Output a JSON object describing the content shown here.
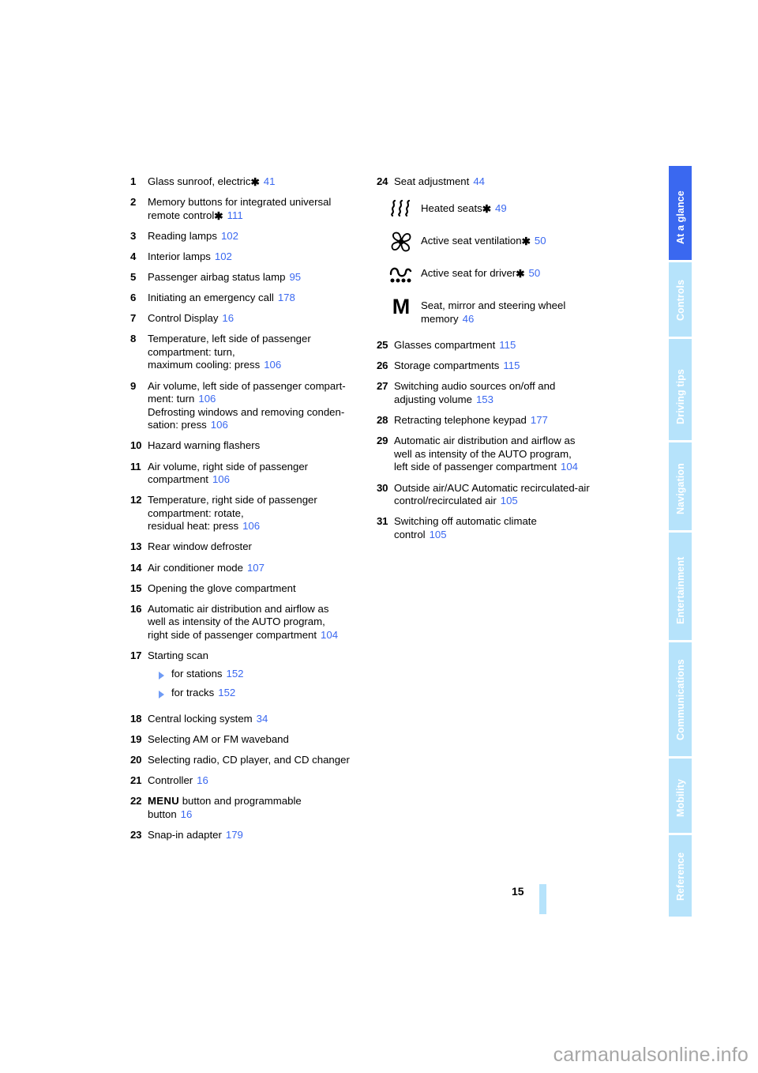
{
  "page": {
    "number": "15",
    "watermark": "carmanualsonline.info"
  },
  "colors": {
    "accent_blue": "#3a68f0",
    "tab_inactive": "#b6e3fb",
    "tab_active": "#3a68f0",
    "watermark_gray": "#a6a6a6"
  },
  "sidebar": {
    "tabs": [
      {
        "label": "At a glance",
        "active": true
      },
      {
        "label": "Controls",
        "active": false
      },
      {
        "label": "Driving tips",
        "active": false
      },
      {
        "label": "Navigation",
        "active": false
      },
      {
        "label": "Entertainment",
        "active": false
      },
      {
        "label": "Communications",
        "active": false
      },
      {
        "label": "Mobility",
        "active": false
      },
      {
        "label": "Reference",
        "active": false
      }
    ]
  },
  "left_column": {
    "entries": [
      {
        "num": "1",
        "lines": [
          {
            "text": "Glass sunroof, electric",
            "star": true,
            "page": "41"
          }
        ]
      },
      {
        "num": "2",
        "lines": [
          {
            "text": "Memory buttons for integrated universal"
          },
          {
            "text": "remote control",
            "star": true,
            "page": "111"
          }
        ]
      },
      {
        "num": "3",
        "lines": [
          {
            "text": "Reading lamps",
            "page": "102"
          }
        ]
      },
      {
        "num": "4",
        "lines": [
          {
            "text": "Interior lamps",
            "page": "102"
          }
        ]
      },
      {
        "num": "5",
        "lines": [
          {
            "text": "Passenger airbag status lamp",
            "page": "95"
          }
        ]
      },
      {
        "num": "6",
        "lines": [
          {
            "text": "Initiating an emergency call",
            "page": "178"
          }
        ]
      },
      {
        "num": "7",
        "lines": [
          {
            "text": "Control Display",
            "page": "16"
          }
        ]
      },
      {
        "num": "8",
        "lines": [
          {
            "text": "Temperature, left side of passenger"
          },
          {
            "text": "compartment: turn,"
          },
          {
            "text": "maximum cooling: press",
            "page": "106"
          }
        ]
      },
      {
        "num": "9",
        "lines": [
          {
            "text": "Air volume, left side of passenger compart-"
          },
          {
            "text": "ment: turn",
            "page": "106"
          },
          {
            "text": "Defrosting windows and removing conden-"
          },
          {
            "text": "sation: press",
            "page": "106"
          }
        ]
      },
      {
        "num": "10",
        "lines": [
          {
            "text": "Hazard warning flashers"
          }
        ]
      },
      {
        "num": "11",
        "lines": [
          {
            "text": "Air volume, right side of passenger"
          },
          {
            "text": "compartment",
            "page": "106"
          }
        ]
      },
      {
        "num": "12",
        "lines": [
          {
            "text": "Temperature, right side of passenger"
          },
          {
            "text": "compartment: rotate,"
          },
          {
            "text": "residual heat: press",
            "page": "106"
          }
        ]
      },
      {
        "num": "13",
        "lines": [
          {
            "text": "Rear window defroster"
          }
        ]
      },
      {
        "num": "14",
        "lines": [
          {
            "text": "Air conditioner mode",
            "page": "107"
          }
        ]
      },
      {
        "num": "15",
        "lines": [
          {
            "text": "Opening the glove compartment"
          }
        ]
      },
      {
        "num": "16",
        "lines": [
          {
            "text": "Automatic air distribution and airflow as"
          },
          {
            "text": "well as intensity of the AUTO program,"
          },
          {
            "text": "right side of passenger compartment",
            "page": "104"
          }
        ]
      },
      {
        "num": "17",
        "lines": [
          {
            "text": "Starting scan"
          }
        ],
        "subs": [
          {
            "text": "for stations",
            "page": "152"
          },
          {
            "text": "for tracks",
            "page": "152"
          }
        ]
      },
      {
        "num": "18",
        "lines": [
          {
            "text": "Central locking system",
            "page": "34"
          }
        ]
      },
      {
        "num": "19",
        "lines": [
          {
            "text": "Selecting AM or FM waveband"
          }
        ]
      },
      {
        "num": "20",
        "lines": [
          {
            "text": "Selecting radio, CD player, and CD changer"
          }
        ]
      },
      {
        "num": "21",
        "lines": [
          {
            "text": "Controller",
            "page": "16"
          }
        ]
      },
      {
        "num": "22",
        "lines": [
          {
            "key": "MENU",
            "text": " button and programmable"
          },
          {
            "text": "button",
            "page": "16"
          }
        ]
      },
      {
        "num": "23",
        "lines": [
          {
            "text": "Snap-in adapter",
            "page": "179"
          }
        ]
      }
    ]
  },
  "right_column": {
    "entry_24": {
      "num": "24",
      "text": "Seat adjustment",
      "page": "44"
    },
    "icon_entries": [
      {
        "icon": "heated-seats-icon",
        "text": "Heated seats",
        "star": true,
        "page": "49"
      },
      {
        "icon": "seat-ventilation-fan-icon",
        "text": "Active seat ventilation",
        "star": true,
        "page": "50"
      },
      {
        "icon": "active-seat-wave-icon",
        "text": "Active seat for driver",
        "star": true,
        "page": "50"
      },
      {
        "icon": "memory-m-icon",
        "lines": [
          "Seat, mirror and steering wheel",
          "memory"
        ],
        "page": "46"
      }
    ],
    "entries": [
      {
        "num": "25",
        "lines": [
          {
            "text": "Glasses compartment",
            "page": "115"
          }
        ]
      },
      {
        "num": "26",
        "lines": [
          {
            "text": "Storage compartments",
            "page": "115"
          }
        ]
      },
      {
        "num": "27",
        "lines": [
          {
            "text": "Switching audio sources on/off and"
          },
          {
            "text": "adjusting volume",
            "page": "153"
          }
        ]
      },
      {
        "num": "28",
        "lines": [
          {
            "text": "Retracting telephone keypad",
            "page": "177"
          }
        ]
      },
      {
        "num": "29",
        "lines": [
          {
            "text": "Automatic air distribution and airflow as"
          },
          {
            "text": "well as intensity of the AUTO program,"
          },
          {
            "text": "left side of passenger compartment",
            "page": "104"
          }
        ]
      },
      {
        "num": "30",
        "lines": [
          {
            "text": "Outside air/AUC Automatic recirculated-air"
          },
          {
            "text": "control/recirculated air",
            "page": "105"
          }
        ]
      },
      {
        "num": "31",
        "lines": [
          {
            "text": "Switching off automatic climate"
          },
          {
            "text": "control",
            "page": "105"
          }
        ]
      }
    ]
  }
}
